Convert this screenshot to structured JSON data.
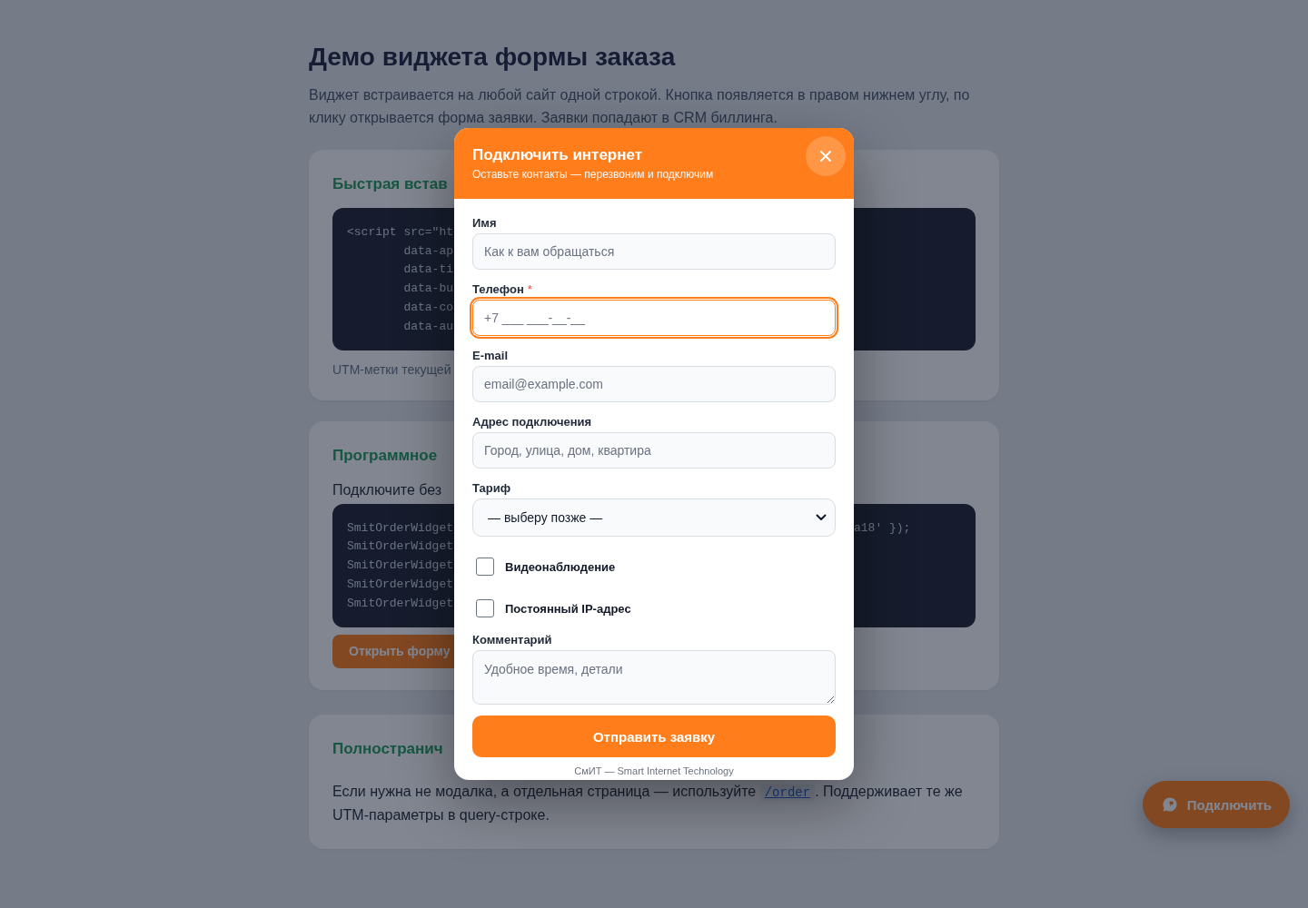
{
  "page": {
    "title": "Демо виджета формы заказа",
    "intro": "Виджет встраивается на любой сайт одной строкой. Кнопка появляется в правом нижнем углу, по клику открывается форма заявки. Заявки попадают в CRM биллинга.",
    "cards": [
      {
        "kind": "snippet",
        "title": "Быстрая встав",
        "code": [
          {
            "text": "<script src=\"ht"
          },
          {
            "text": "        data-ap"
          },
          {
            "text": "        data-ti"
          },
          {
            "text": "        data-bu"
          },
          {
            "text": "        data-co"
          },
          {
            "text": "        data-au"
          }
        ],
        "note": "UTM-метки текущей"
      },
      {
        "kind": "api",
        "title": "Программное",
        "text": "Подключите без",
        "code": [
          {
            "text": "SmitOrderWidget",
            "tail": "a18' });"
          },
          {
            "text": "SmitOrderWidget"
          },
          {
            "text": "SmitOrderWidget"
          },
          {
            "text": "SmitOrderWidget"
          },
          {
            "text": "SmitOrderWidget"
          }
        ],
        "button": "Открыть форму"
      },
      {
        "kind": "fullpage",
        "title": "Полностранич",
        "text_before": "Если нужна не модалка, а отдельная страница — используйте ",
        "link": "/order",
        "text_after": ". Поддерживает те же UTM-параметры в query-строке."
      }
    ]
  },
  "modal": {
    "title": "Подключить интернет",
    "subtitle": "Оставьте контакты — перезвоним и подключим",
    "fields": [
      {
        "kind": "input",
        "label": "Имя",
        "placeholder": "Как к вам обращаться",
        "focused": false
      },
      {
        "kind": "input",
        "label": "Телефон",
        "required_mark": "*",
        "placeholder": "+7 ___ ___-__-__",
        "focused": true
      },
      {
        "kind": "input",
        "label": "E-mail",
        "placeholder": "email@example.com",
        "focused": false
      },
      {
        "kind": "input",
        "label": "Адрес подключения",
        "placeholder": "Город, улица, дом, квартира",
        "focused": false
      },
      {
        "kind": "select",
        "label": "Тариф",
        "value": "— выберу позже —",
        "focused": false
      },
      {
        "kind": "checkbox",
        "label": "Видеонаблюдение",
        "checked": false
      },
      {
        "kind": "checkbox",
        "label": "Постоянный IP-адрес",
        "checked": false
      },
      {
        "kind": "textarea",
        "label": "Комментарий",
        "placeholder": "Удобное время, детали",
        "focused": false
      }
    ],
    "submit": "Отправить заявку",
    "footer": "СмИТ — Smart Internet Technology"
  },
  "floating_button": {
    "label": "Подключить"
  }
}
